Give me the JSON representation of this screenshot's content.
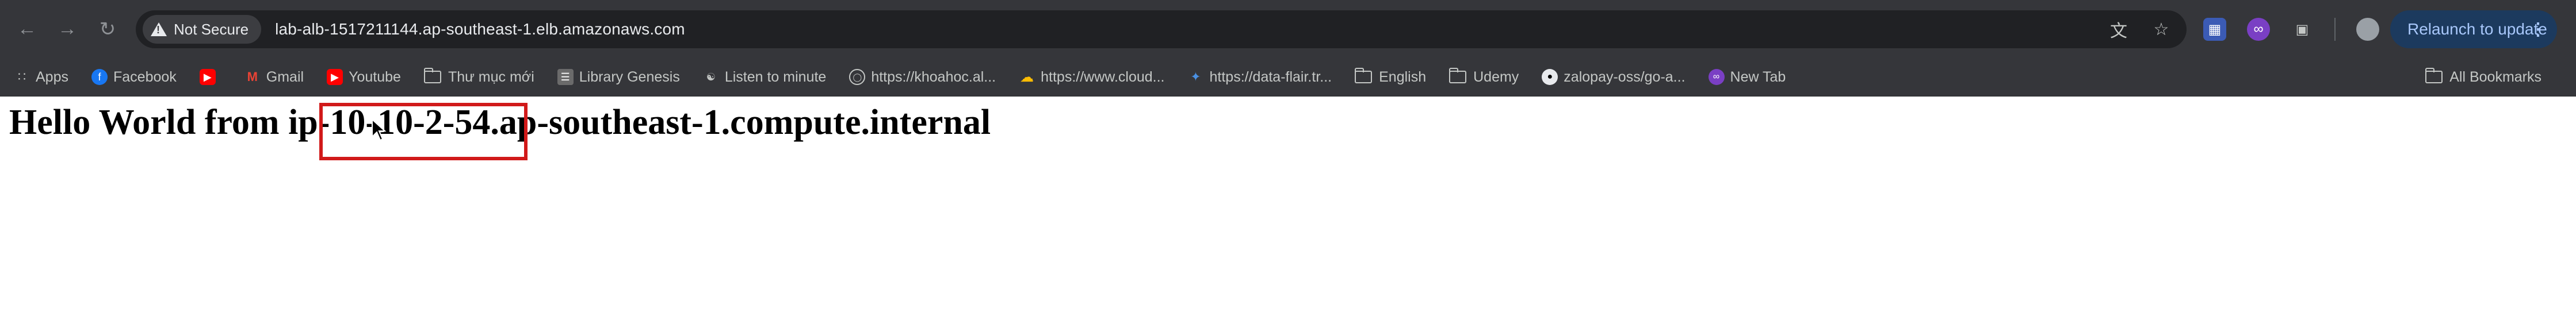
{
  "browser": {
    "nav": {
      "back_icon": "arrow-left-icon",
      "forward_icon": "arrow-right-icon",
      "reload_icon": "reload-icon"
    },
    "omnibox": {
      "security_label": "Not Secure",
      "url": "lab-alb-1517211144.ap-southeast-1.elb.amazonaws.com"
    },
    "relaunch_label": "Relaunch to update",
    "accent_color": "#1c3a5e"
  },
  "bookmarks": {
    "items": [
      {
        "label": "Apps",
        "icon": "apps-grid-icon"
      },
      {
        "label": "Facebook",
        "icon": "facebook-icon"
      },
      {
        "label": "",
        "icon": "youtube-icon"
      },
      {
        "label": "Gmail",
        "icon": "gmail-icon"
      },
      {
        "label": "Youtube",
        "icon": "youtube-icon"
      },
      {
        "label": "Thư mục mới",
        "icon": "folder-icon"
      },
      {
        "label": "Library Genesis",
        "icon": "library-icon"
      },
      {
        "label": "Listen to minute",
        "icon": "listen-icon"
      },
      {
        "label": "https://khoahoc.al...",
        "icon": "globe-icon"
      },
      {
        "label": "https://www.cloud...",
        "icon": "cloud-icon"
      },
      {
        "label": "https://data-flair.tr...",
        "icon": "dataflair-icon"
      },
      {
        "label": "English",
        "icon": "folder-icon"
      },
      {
        "label": "Udemy",
        "icon": "folder-icon"
      },
      {
        "label": "zalopay-oss/go-a...",
        "icon": "github-icon"
      },
      {
        "label": "New Tab",
        "icon": "extension-icon"
      }
    ],
    "all_bookmarks_label": "All Bookmarks"
  },
  "page": {
    "heading": "Hello World from ip-10-10-2-54.ap-southeast-1.compute.internal"
  }
}
